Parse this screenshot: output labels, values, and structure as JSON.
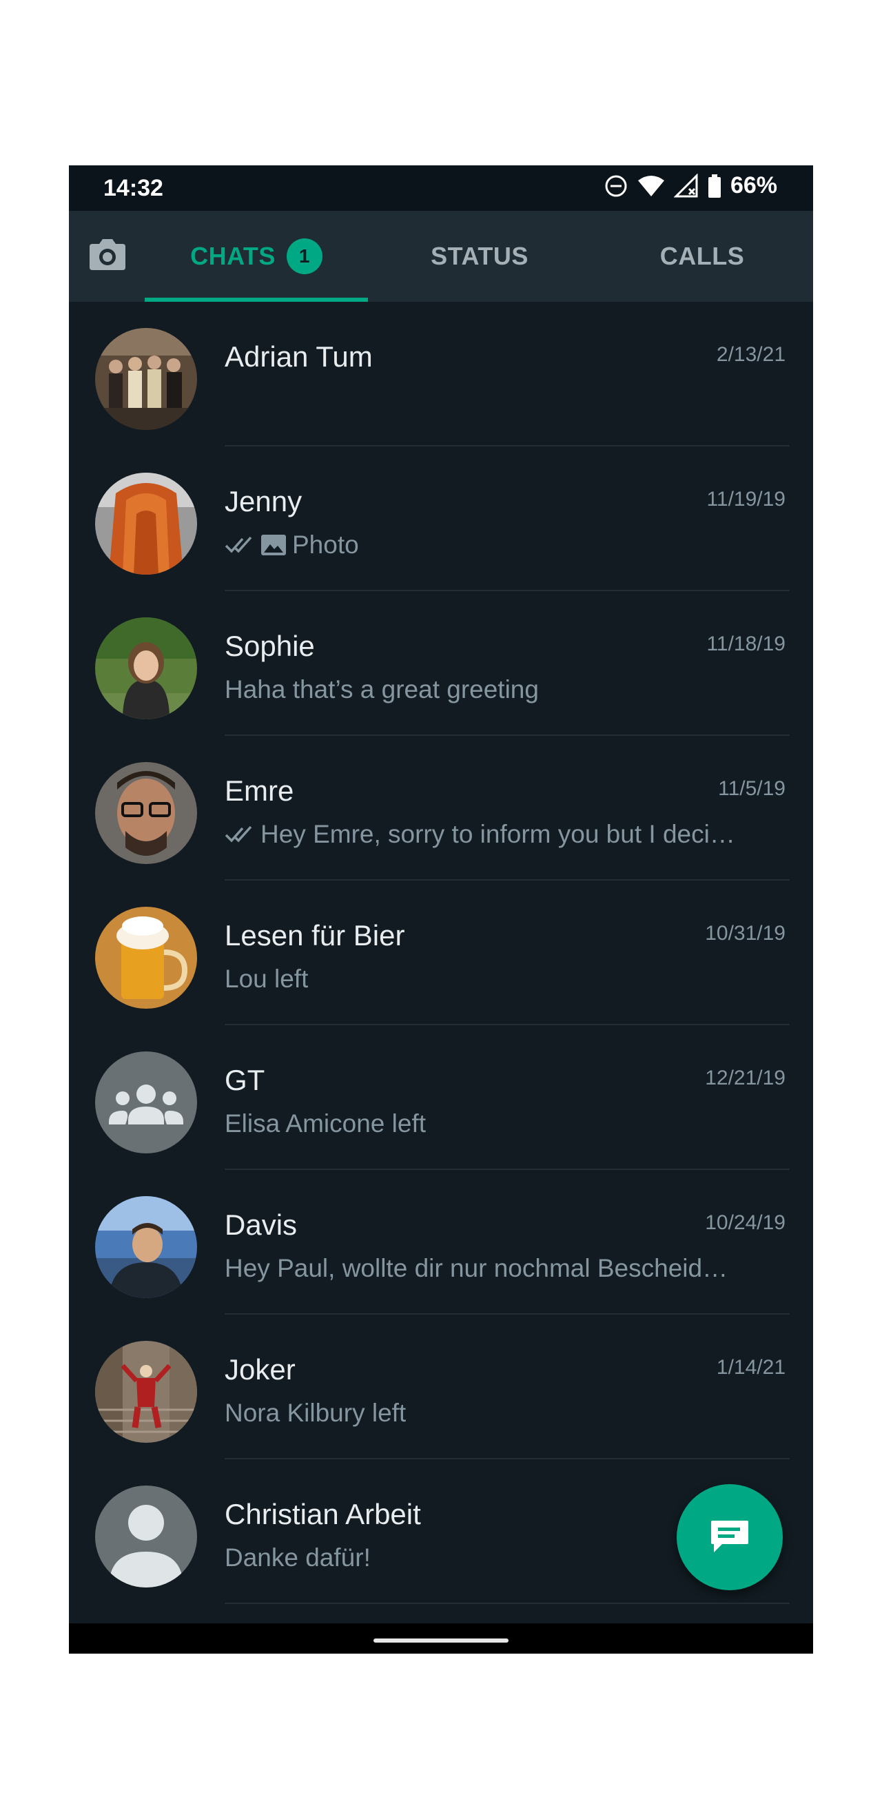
{
  "status_bar": {
    "time": "14:32",
    "battery": "66%",
    "icons": [
      "do-not-disturb-icon",
      "wifi-icon",
      "cell-signal-icon",
      "battery-icon"
    ]
  },
  "tabs": [
    {
      "label": "CHATS",
      "badge": "1",
      "active": true
    },
    {
      "label": "STATUS",
      "active": false
    },
    {
      "label": "CALLS",
      "active": false
    }
  ],
  "chats": [
    {
      "name": "Adrian Tum",
      "date": "2/13/21",
      "preview": ""
    },
    {
      "name": "Jenny",
      "date": "11/19/19",
      "preview": "Photo"
    },
    {
      "name": "Sophie",
      "date": "11/18/19",
      "preview": "Haha that’s a great greeting"
    },
    {
      "name": "Emre",
      "date": "11/5/19",
      "preview": "Hey Emre, sorry to inform you but I deci…"
    },
    {
      "name": "Lesen für Bier",
      "date": "10/31/19",
      "preview": "Lou left"
    },
    {
      "name": "GT",
      "date": "12/21/19",
      "preview": "Elisa Amicone left"
    },
    {
      "name": "Davis",
      "date": "10/24/19",
      "preview": "Hey Paul, wollte dir nur nochmal Bescheid…"
    },
    {
      "name": "Joker",
      "date": "1/14/21",
      "preview": "Nora Kilbury left"
    },
    {
      "name": "Christian Arbeit",
      "date": "",
      "preview": "Danke dafür!"
    }
  ],
  "colors": {
    "accent": "#00a884",
    "background": "#111b21",
    "appbar": "#1f2c34",
    "text_primary": "#e9edef",
    "text_secondary": "#8696a0"
  }
}
